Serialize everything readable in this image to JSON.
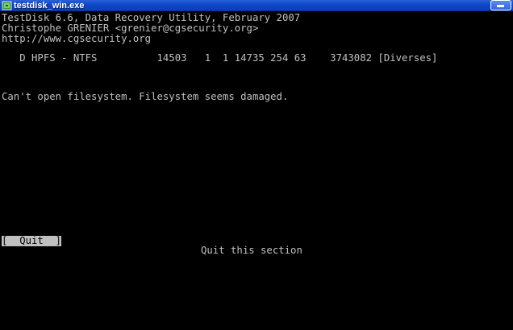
{
  "window": {
    "title": "testdisk_win.exe",
    "icon": "testdisk-app-icon"
  },
  "console": {
    "header_lines": [
      "TestDisk 6.6, Data Recovery Utility, February 2007",
      "Christophe GRENIER <grenier@cgsecurity.org>",
      "http://www.cgsecurity.org"
    ],
    "partition_line": "   D HPFS - NTFS          14503   1  1 14735 254 63    3743082 [Diverses]",
    "error_message": "Can't open filesystem. Filesystem seems damaged.",
    "quit_button_label": "[  Quit  ]",
    "status_text": "Quit this section"
  },
  "colors": {
    "titlebar_blue": "#0d47c9",
    "console_background": "#000000",
    "console_text": "#c0c0c0",
    "selected_background": "#c0c0c0"
  }
}
